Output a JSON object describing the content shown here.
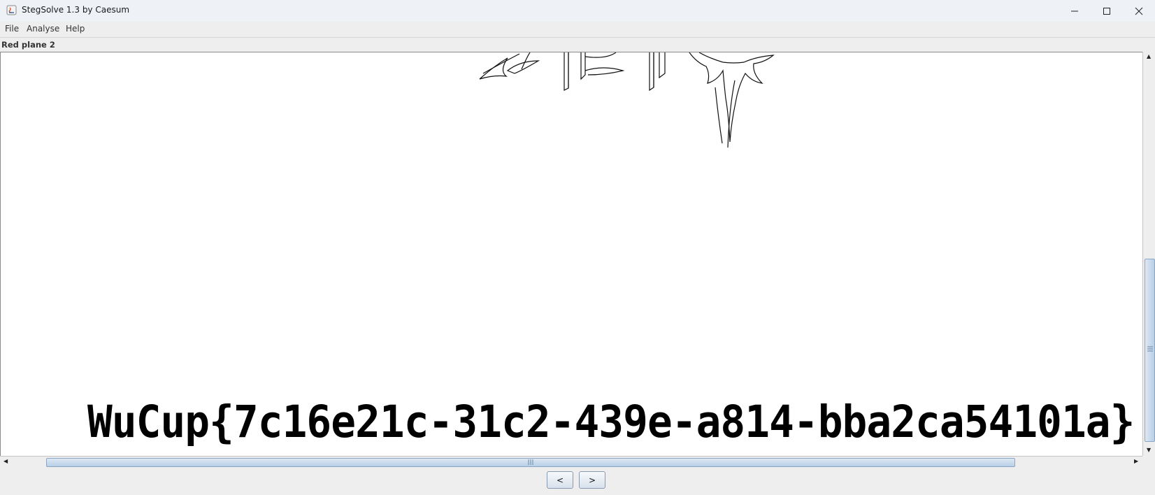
{
  "window": {
    "title": "StegSolve 1.3 by Caesum",
    "icon": "java-icon"
  },
  "menu": {
    "items": [
      "File",
      "Analyse",
      "Help"
    ]
  },
  "view": {
    "plane_label": "Red plane 2",
    "flag_text": "WuCup{7c16e21c-31c2-439e-a814-bba2ca54101a}"
  },
  "nav": {
    "prev_label": "<",
    "next_label": ">"
  },
  "colors": {
    "thumb": "#b8cfe6",
    "background": "#ffffff"
  }
}
